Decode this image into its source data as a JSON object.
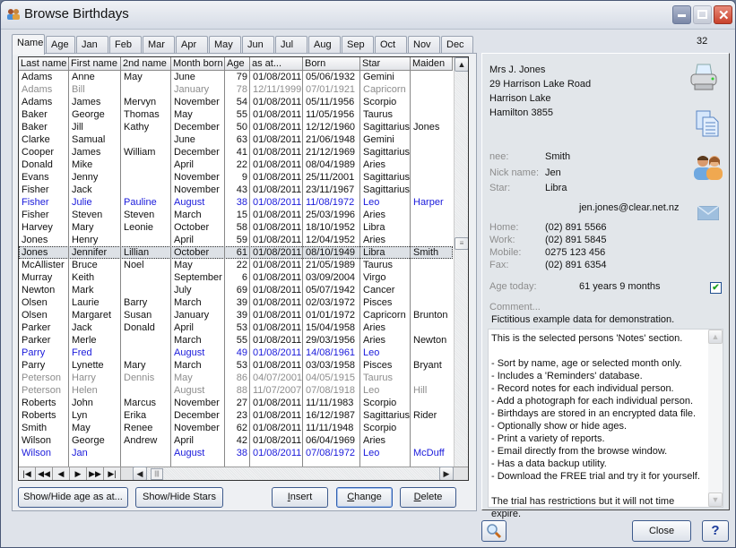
{
  "window": {
    "title": "Browse Birthdays",
    "controls": {
      "minimize": "–",
      "maximize": "□",
      "close": "✕"
    }
  },
  "tabs": [
    {
      "label": "Name",
      "active": true
    },
    {
      "label": "Age"
    },
    {
      "label": "Jan"
    },
    {
      "label": "Feb"
    },
    {
      "label": "Mar"
    },
    {
      "label": "Apr"
    },
    {
      "label": "May"
    },
    {
      "label": "Jun"
    },
    {
      "label": "Jul"
    },
    {
      "label": "Aug"
    },
    {
      "label": "Sep"
    },
    {
      "label": "Oct"
    },
    {
      "label": "Nov"
    },
    {
      "label": "Dec"
    }
  ],
  "record_count": "32",
  "grid": {
    "columns": [
      "Last name",
      "First name",
      "2nd name",
      "Month born",
      "Age",
      "as at...",
      "Born",
      "Star",
      "Maiden"
    ],
    "rows": [
      {
        "style": "black",
        "cells": [
          "Adams",
          "Anne",
          "May",
          "June",
          "79",
          "01/08/2011",
          "05/06/1932",
          "Gemini",
          ""
        ]
      },
      {
        "style": "gray",
        "cells": [
          "Adams",
          "Bill",
          "",
          "January",
          "78",
          "12/11/1999",
          "07/01/1921",
          "Capricorn",
          ""
        ]
      },
      {
        "style": "black",
        "cells": [
          "Adams",
          "James",
          "Mervyn",
          "November",
          "54",
          "01/08/2011",
          "05/11/1956",
          "Scorpio",
          ""
        ]
      },
      {
        "style": "black",
        "cells": [
          "Baker",
          "George",
          "Thomas",
          "May",
          "55",
          "01/08/2011",
          "11/05/1956",
          "Taurus",
          ""
        ]
      },
      {
        "style": "black",
        "cells": [
          "Baker",
          "Jill",
          "Kathy",
          "December",
          "50",
          "01/08/2011",
          "12/12/1960",
          "Sagittarius",
          "Jones"
        ]
      },
      {
        "style": "black",
        "cells": [
          "Clarke",
          "Samual",
          "",
          "June",
          "63",
          "01/08/2011",
          "21/06/1948",
          "Gemini",
          ""
        ]
      },
      {
        "style": "black",
        "cells": [
          "Cooper",
          "James",
          "William",
          "December",
          "41",
          "01/08/2011",
          "21/12/1969",
          "Sagittarius",
          ""
        ]
      },
      {
        "style": "black",
        "cells": [
          "Donald",
          "Mike",
          "",
          "April",
          "22",
          "01/08/2011",
          "08/04/1989",
          "Aries",
          ""
        ]
      },
      {
        "style": "black",
        "cells": [
          "Evans",
          "Jenny",
          "",
          "November",
          "9",
          "01/08/2011",
          "25/11/2001",
          "Sagittarius",
          ""
        ]
      },
      {
        "style": "black",
        "cells": [
          "Fisher",
          "Jack",
          "",
          "November",
          "43",
          "01/08/2011",
          "23/11/1967",
          "Sagittarius",
          ""
        ]
      },
      {
        "style": "blue",
        "cells": [
          "Fisher",
          "Julie",
          "Pauline",
          "August",
          "38",
          "01/08/2011",
          "11/08/1972",
          "Leo",
          "Harper"
        ]
      },
      {
        "style": "black",
        "cells": [
          "Fisher",
          "Steven",
          "Steven",
          "March",
          "15",
          "01/08/2011",
          "25/03/1996",
          "Aries",
          ""
        ]
      },
      {
        "style": "black",
        "cells": [
          "Harvey",
          "Mary",
          "Leonie",
          "October",
          "58",
          "01/08/2011",
          "18/10/1952",
          "Libra",
          ""
        ]
      },
      {
        "style": "black",
        "cells": [
          "Jones",
          "Henry",
          "",
          "April",
          "59",
          "01/08/2011",
          "12/04/1952",
          "Aries",
          ""
        ]
      },
      {
        "style": "black",
        "selected": true,
        "cells": [
          "Jones",
          "Jennifer",
          "Lillian",
          "October",
          "61",
          "01/08/2011",
          "08/10/1949",
          "Libra",
          "Smith"
        ]
      },
      {
        "style": "black",
        "cells": [
          "McAllister",
          "Bruce",
          "Noel",
          "May",
          "22",
          "01/08/2011",
          "21/05/1989",
          "Taurus",
          ""
        ]
      },
      {
        "style": "black",
        "cells": [
          "Murray",
          "Keith",
          "",
          "September",
          "6",
          "01/08/2011",
          "03/09/2004",
          "Virgo",
          ""
        ]
      },
      {
        "style": "black",
        "cells": [
          "Newton",
          "Mark",
          "",
          "July",
          "69",
          "01/08/2011",
          "05/07/1942",
          "Cancer",
          ""
        ]
      },
      {
        "style": "black",
        "cells": [
          "Olsen",
          "Laurie",
          "Barry",
          "March",
          "39",
          "01/08/2011",
          "02/03/1972",
          "Pisces",
          ""
        ]
      },
      {
        "style": "black",
        "cells": [
          "Olsen",
          "Margaret",
          "Susan",
          "January",
          "39",
          "01/08/2011",
          "01/01/1972",
          "Capricorn",
          "Brunton"
        ]
      },
      {
        "style": "black",
        "cells": [
          "Parker",
          "Jack",
          "Donald",
          "April",
          "53",
          "01/08/2011",
          "15/04/1958",
          "Aries",
          ""
        ]
      },
      {
        "style": "black",
        "cells": [
          "Parker",
          "Merle",
          "",
          "March",
          "55",
          "01/08/2011",
          "29/03/1956",
          "Aries",
          "Newton"
        ]
      },
      {
        "style": "blue",
        "cells": [
          "Parry",
          "Fred",
          "",
          "August",
          "49",
          "01/08/2011",
          "14/08/1961",
          "Leo",
          ""
        ]
      },
      {
        "style": "black",
        "cells": [
          "Parry",
          "Lynette",
          "Mary",
          "March",
          "53",
          "01/08/2011",
          "03/03/1958",
          "Pisces",
          "Bryant"
        ]
      },
      {
        "style": "gray",
        "cells": [
          "Peterson",
          "Harry",
          "Dennis",
          "May",
          "86",
          "04/07/2001",
          "04/05/1915",
          "Taurus",
          ""
        ]
      },
      {
        "style": "gray",
        "cells": [
          "Peterson",
          "Helen",
          "",
          "August",
          "88",
          "11/07/2007",
          "07/08/1918",
          "Leo",
          "Hill"
        ]
      },
      {
        "style": "black",
        "cells": [
          "Roberts",
          "John",
          "Marcus",
          "November",
          "27",
          "01/08/2011",
          "11/11/1983",
          "Scorpio",
          ""
        ]
      },
      {
        "style": "black",
        "cells": [
          "Roberts",
          "Lyn",
          "Erika",
          "December",
          "23",
          "01/08/2011",
          "16/12/1987",
          "Sagittarius",
          "Rider"
        ]
      },
      {
        "style": "black",
        "cells": [
          "Smith",
          "May",
          "Renee",
          "November",
          "62",
          "01/08/2011",
          "11/11/1948",
          "Scorpio",
          ""
        ]
      },
      {
        "style": "black",
        "cells": [
          "Wilson",
          "George",
          "Andrew",
          "April",
          "42",
          "01/08/2011",
          "06/04/1969",
          "Aries",
          ""
        ]
      },
      {
        "style": "blue",
        "cells": [
          "Wilson",
          "Jan",
          "",
          "August",
          "38",
          "01/08/2011",
          "07/08/1972",
          "Leo",
          "McDuff"
        ]
      }
    ]
  },
  "nav_buttons": [
    {
      "name": "first-record-button",
      "glyph": "|◀"
    },
    {
      "name": "prev-page-button",
      "glyph": "◀◀"
    },
    {
      "name": "prev-record-button",
      "glyph": "◀"
    },
    {
      "name": "next-record-button",
      "glyph": "▶"
    },
    {
      "name": "next-page-button",
      "glyph": "▶▶"
    },
    {
      "name": "last-record-button",
      "glyph": "▶|"
    }
  ],
  "buttons": {
    "show_hide_age": "Show/Hide age as at...",
    "show_hide_stars": "Show/Hide Stars",
    "insert": {
      "pre": "",
      "u": "I",
      "post": "nsert"
    },
    "change": {
      "pre": "",
      "u": "C",
      "post": "hange"
    },
    "delete": {
      "pre": "",
      "u": "D",
      "post": "elete"
    },
    "close": "Close",
    "help": "?"
  },
  "details": {
    "address": [
      "Mrs J. Jones",
      "29 Harrison Lake Road",
      "Harrison Lake",
      "Hamilton 3855"
    ],
    "nee_label": "nee:",
    "nee": "Smith",
    "nick_label": "Nick name:",
    "nick": "Jen",
    "star_label": "Star:",
    "star": "Libra",
    "email": "jen.jones@clear.net.nz",
    "home_label": "Home:",
    "home": "(02) 891 5566",
    "work_label": "Work:",
    "work": "(02) 891 5845",
    "mobile_label": "Mobile:",
    "mobile": "0275 123 456",
    "fax_label": "Fax:",
    "fax": "(02) 891 6354",
    "age_label": "Age today:",
    "age": "61 years 9 months",
    "age_checked": true,
    "comment_label": "Comment...",
    "comment": "Fictitious example data for demonstration.",
    "notes": "This is the selected persons 'Notes' section.\n\n- Sort by name, age or selected month only.\n- Includes a 'Reminders' database.\n- Record notes for each individual person.\n- Add a photograph for each individual person.\n- Birthdays are stored in an encrypted data file.\n- Optionally show or hide ages.\n- Print a variety of reports.\n- Email directly from the browse window.\n- Has a data backup utility.\n- Download the FREE trial and try it for yourself.\n\nThe trial has restrictions but it will not time expire."
  },
  "colors": {
    "normal": "#111111",
    "past": "#8d8d8d",
    "this_month": "#1a1adb"
  }
}
